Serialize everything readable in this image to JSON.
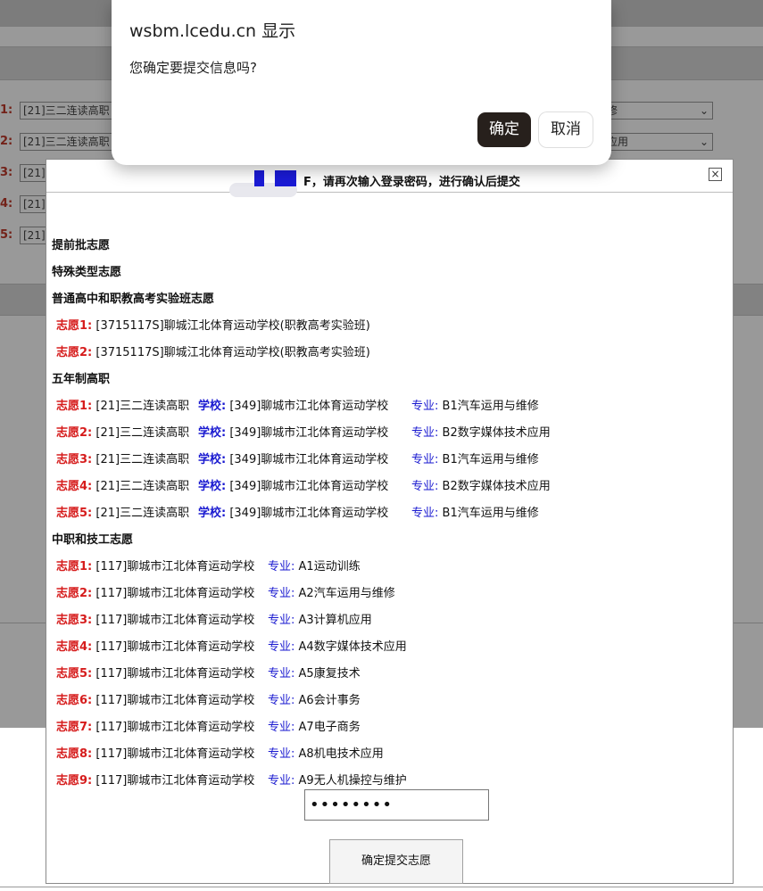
{
  "dialog": {
    "origin": "wsbm.lcedu.cn 显示",
    "message": "您确定要提交信息吗?",
    "ok_label": "确定",
    "cancel_label": "取消"
  },
  "background": {
    "rows": [
      {
        "num": "1:",
        "select": "[21]三二连读高职",
        "right_select": "修"
      },
      {
        "num": "2:",
        "select": "[21]三二连读高职",
        "right_select": "应用"
      },
      {
        "num": "3:",
        "select": "[21]"
      },
      {
        "num": "4:",
        "select": "[21]"
      },
      {
        "num": "5:",
        "select": "[21]"
      }
    ]
  },
  "panel": {
    "title": "F，请再次输入登录密码，进行确认后提交",
    "close_label": "×",
    "sections": {
      "early": "提前批志愿",
      "special": "特殊类型志愿",
      "experimental": "普通高中和职教高考实验班志愿",
      "five_year": "五年制高职",
      "secondary": "中职和技工志愿"
    },
    "experimental_rows": [
      {
        "label": "志愿1:",
        "value": "[3715117S]聊城江北体育运动学校(职教高考实验班)"
      },
      {
        "label": "志愿2:",
        "value": "[3715117S]聊城江北体育运动学校(职教高考实验班)"
      }
    ],
    "school_key": "学校:",
    "major_key": "专业:",
    "five_year_rows": [
      {
        "label": "志愿1:",
        "program": "[21]三二连读高职",
        "school": "[349]聊城市江北体育运动学校",
        "major": "B1汽车运用与维修"
      },
      {
        "label": "志愿2:",
        "program": "[21]三二连读高职",
        "school": "[349]聊城市江北体育运动学校",
        "major": "B2数字媒体技术应用"
      },
      {
        "label": "志愿3:",
        "program": "[21]三二连读高职",
        "school": "[349]聊城市江北体育运动学校",
        "major": "B1汽车运用与维修"
      },
      {
        "label": "志愿4:",
        "program": "[21]三二连读高职",
        "school": "[349]聊城市江北体育运动学校",
        "major": "B2数字媒体技术应用"
      },
      {
        "label": "志愿5:",
        "program": "[21]三二连读高职",
        "school": "[349]聊城市江北体育运动学校",
        "major": "B1汽车运用与维修"
      }
    ],
    "secondary_rows": [
      {
        "label": "志愿1:",
        "school": "[117]聊城市江北体育运动学校",
        "major": "A1运动训练"
      },
      {
        "label": "志愿2:",
        "school": "[117]聊城市江北体育运动学校",
        "major": "A2汽车运用与维修"
      },
      {
        "label": "志愿3:",
        "school": "[117]聊城市江北体育运动学校",
        "major": "A3计算机应用"
      },
      {
        "label": "志愿4:",
        "school": "[117]聊城市江北体育运动学校",
        "major": "A4数字媒体技术应用"
      },
      {
        "label": "志愿5:",
        "school": "[117]聊城市江北体育运动学校",
        "major": "A5康复技术"
      },
      {
        "label": "志愿6:",
        "school": "[117]聊城市江北体育运动学校",
        "major": "A6会计事务"
      },
      {
        "label": "志愿7:",
        "school": "[117]聊城市江北体育运动学校",
        "major": "A7电子商务"
      },
      {
        "label": "志愿8:",
        "school": "[117]聊城市江北体育运动学校",
        "major": "A8机电技术应用"
      },
      {
        "label": "志愿9:",
        "school": "[117]聊城市江北体育运动学校",
        "major": "A9无人机操控与维护"
      }
    ],
    "password_value": "••••••••",
    "submit_label": "确定提交志愿"
  },
  "colors": {
    "label_red": "#d61c1c",
    "key_blue": "#1a1ad0",
    "dialog_ok": "#27201c",
    "redaction_blue": "#1b1bd6"
  }
}
